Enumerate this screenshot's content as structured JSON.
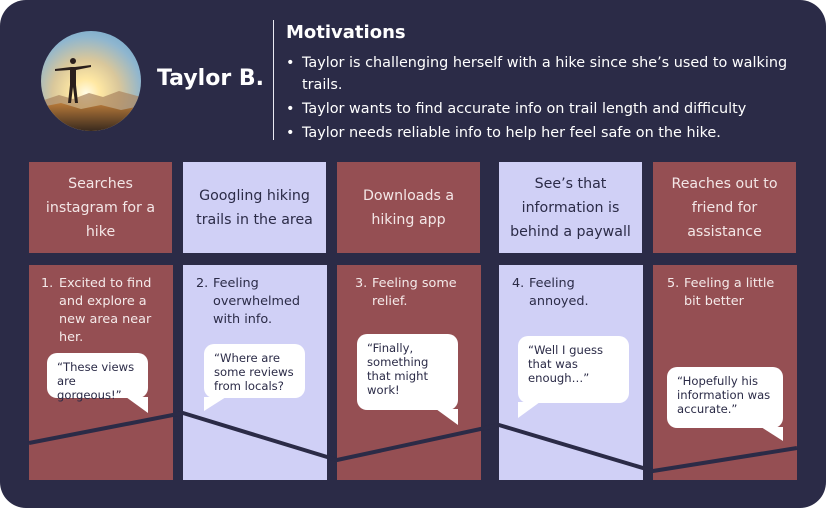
{
  "persona": {
    "name": "Taylor B.",
    "avatar_icon": "hiker-sunset-photo"
  },
  "motivations": {
    "title": "Motivations",
    "items": [
      "Taylor is challenging herself  with a hike since she’s used to walking trails.",
      "Taylor wants to find accurate info on trail length and difficulty",
      "Taylor needs reliable info to help her feel safe on the hike."
    ],
    "bullet": "•"
  },
  "stages": [
    {
      "label": "Searches instagram for a hike"
    },
    {
      "label": "Googling hiking trails in the area"
    },
    {
      "label": "Downloads a hiking app"
    },
    {
      "label": "See’s that information is behind a paywall"
    },
    {
      "label": "Reaches out to friend for assistance"
    }
  ],
  "feelings": [
    {
      "number": "1.",
      "text": "Excited to find and explore a new area near her.",
      "quote": "“These views are gorgeous!”"
    },
    {
      "number": "2.",
      "text": "Feeling overwhelmed with info.",
      "quote": "“Where are some reviews from locals?"
    },
    {
      "number": "3.",
      "text": "Feeling some relief.",
      "quote": "“Finally, something that might work!"
    },
    {
      "number": "4.",
      "text": "Feeling annoyed.",
      "quote": "“Well I guess that was enough…”"
    },
    {
      "number": "5.",
      "text": "Feeling a little bit better",
      "quote": "“Hopefully his information was accurate.”"
    }
  ],
  "colors": {
    "background": "#2b2b47",
    "stage_dark": "#954f53",
    "stage_light": "#d0d0f6",
    "line": "#2b2b47"
  }
}
